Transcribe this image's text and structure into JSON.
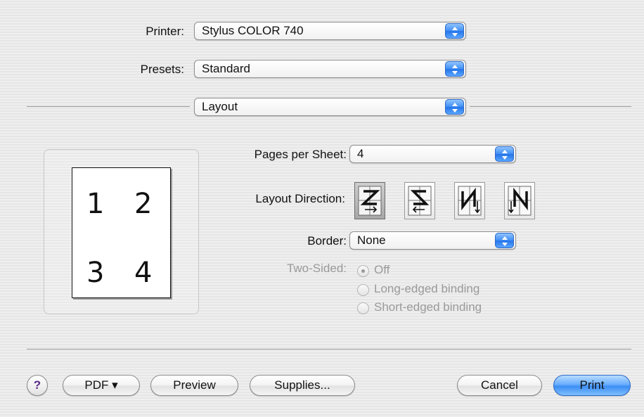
{
  "printer": {
    "label": "Printer:",
    "value": "Stylus COLOR 740"
  },
  "presets": {
    "label": "Presets:",
    "value": "Standard"
  },
  "pane": {
    "value": "Layout"
  },
  "preview": {
    "pages": [
      "1",
      "2",
      "3",
      "4"
    ]
  },
  "layout": {
    "pages_per_sheet": {
      "label": "Pages per Sheet:",
      "value": "4"
    },
    "direction": {
      "label": "Layout Direction:",
      "options": [
        "z-order",
        "reverse-z-order",
        "n-order",
        "reverse-n-order"
      ],
      "selected_index": 0
    },
    "border": {
      "label": "Border:",
      "value": "None"
    },
    "two_sided": {
      "label": "Two-Sided:",
      "options": [
        "Off",
        "Long-edged binding",
        "Short-edged binding"
      ],
      "selected_index": 0
    }
  },
  "buttons": {
    "help": "?",
    "pdf": "PDF ▾",
    "preview": "Preview",
    "supplies": "Supplies...",
    "cancel": "Cancel",
    "print": "Print"
  },
  "colors": {
    "accent": "#3c8ef4"
  }
}
